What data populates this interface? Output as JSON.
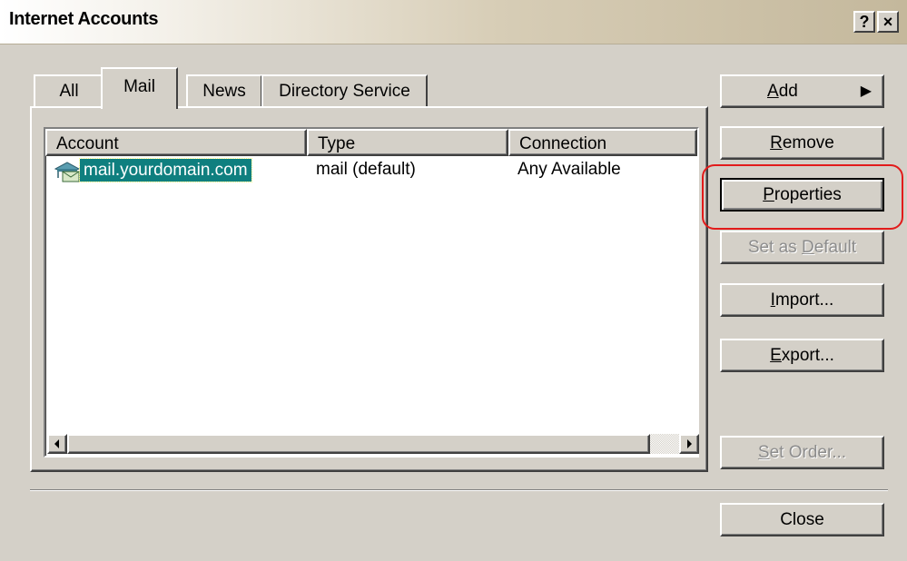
{
  "window": {
    "title": "Internet Accounts",
    "help_glyph": "?",
    "close_glyph": "×"
  },
  "tabs": [
    {
      "label": "All"
    },
    {
      "label": "Mail"
    },
    {
      "label": "News"
    },
    {
      "label": "Directory Service"
    }
  ],
  "active_tab": "Mail",
  "list": {
    "columns": [
      "Account",
      "Type",
      "Connection"
    ],
    "rows": [
      {
        "account": "mail.yourdomain.com",
        "type": "mail (default)",
        "connection": "Any Available",
        "selected": true
      }
    ]
  },
  "buttons": {
    "add": {
      "first": "A",
      "rest": "dd",
      "arrow": "▶"
    },
    "remove": {
      "first": "R",
      "rest": "emove"
    },
    "properties": {
      "first": "P",
      "rest": "roperties"
    },
    "set_default": {
      "pre": "Set as ",
      "first": "D",
      "rest": "efault",
      "disabled": true
    },
    "import": {
      "first": "I",
      "rest": "mport..."
    },
    "export": {
      "first": "E",
      "rest": "xport..."
    },
    "set_order": {
      "first": "S",
      "rest": "et Order...",
      "disabled": true
    },
    "close": {
      "label": "Close"
    }
  },
  "colors": {
    "selection": "#0f7f7f",
    "annotation_ring": "#e21b1b",
    "face": "#d4d0c8"
  }
}
